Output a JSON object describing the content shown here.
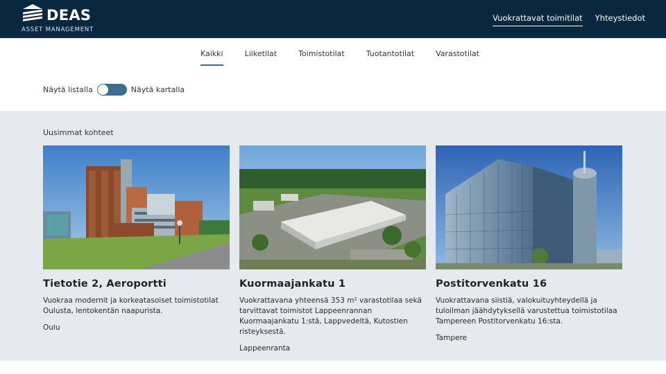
{
  "brand": {
    "name": "DEAS",
    "tagline": "ASSET MANAGEMENT"
  },
  "topnav": [
    {
      "label": "Vuokrattavat toimitilat",
      "active": true
    },
    {
      "label": "Yhteystiedot",
      "active": false
    }
  ],
  "tabs": [
    {
      "label": "Kaikki",
      "active": true
    },
    {
      "label": "Liiketilat",
      "active": false
    },
    {
      "label": "Toimistotilat",
      "active": false
    },
    {
      "label": "Tuotantotilat",
      "active": false
    },
    {
      "label": "Varastotilat",
      "active": false
    }
  ],
  "view_toggle": {
    "left_label": "Näytä listalla",
    "right_label": "Näytä kartalla",
    "state": "list"
  },
  "latest": {
    "title": "Uusimmat kohteet",
    "cards": [
      {
        "title": "Tietotie 2, Aeroportti",
        "description": "Vuokraa modernit ja korkeatasoiset toimistotilat Oulusta, lentokentän naapurista.",
        "city": "Oulu",
        "image": "office-building-photo"
      },
      {
        "title": "Kuormaajankatu 1",
        "description": "Vuokrattavana yhteensä 353 m² varastotilaa sekä tarvittavat toimistot Lappeenrannan Kuormaajankatu 1:stä, Lappvedeltä, Kutostien risteyksestä.",
        "city": "Lappeenranta",
        "image": "warehouse-aerial-photo"
      },
      {
        "title": "Postitorvenkatu 16",
        "description": "Vuokrattavana siistiä, valokuituyhteydellä ja tuloilman jäähdytyksellä varustettua toimistotilaa Tampereen Postitorvenkatu 16:sta.",
        "city": "Tampere",
        "image": "glass-tower-photo"
      }
    ]
  },
  "colors": {
    "header": "#0a2740",
    "accent": "#3b6e90",
    "section_bg": "#e6e9ee"
  }
}
